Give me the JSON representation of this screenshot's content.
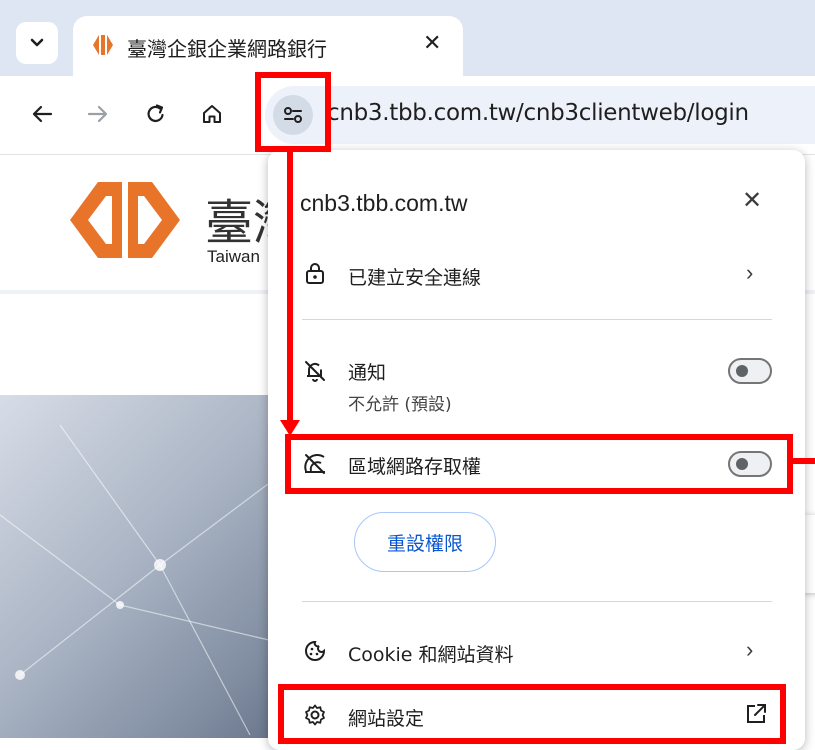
{
  "browser": {
    "tab": {
      "title": "臺灣企銀企業網路銀行",
      "close_glyph": "✕",
      "menu_glyph": "⌄"
    },
    "toolbar": {
      "back_glyph": "←",
      "forward_glyph": "→",
      "url": "cnb3.tbb.com.tw/cnb3clientweb/login"
    }
  },
  "page": {
    "title_partial": "臺灣",
    "subtitle_partial": "Taiwan"
  },
  "popup": {
    "domain": "cnb3.tbb.com.tw",
    "close_glyph": "✕",
    "secure_connection": {
      "label": "已建立安全連線",
      "chevron": "›"
    },
    "notifications": {
      "label": "通知",
      "sub": "不允許 (預設)",
      "enabled": false
    },
    "local_network": {
      "label": "區域網路存取權",
      "enabled": false
    },
    "reset_button": "重設權限",
    "cookies": {
      "label": "Cookie 和網站資料",
      "chevron": "›"
    },
    "site_settings": {
      "label": "網站設定"
    }
  },
  "colors": {
    "annotation_red": "#ff0000",
    "accent_blue": "#0b57d0",
    "logo_orange": "#e8742a",
    "tabstrip_bg": "#dfe6f3",
    "omnibox_bg": "#edf2fa"
  }
}
